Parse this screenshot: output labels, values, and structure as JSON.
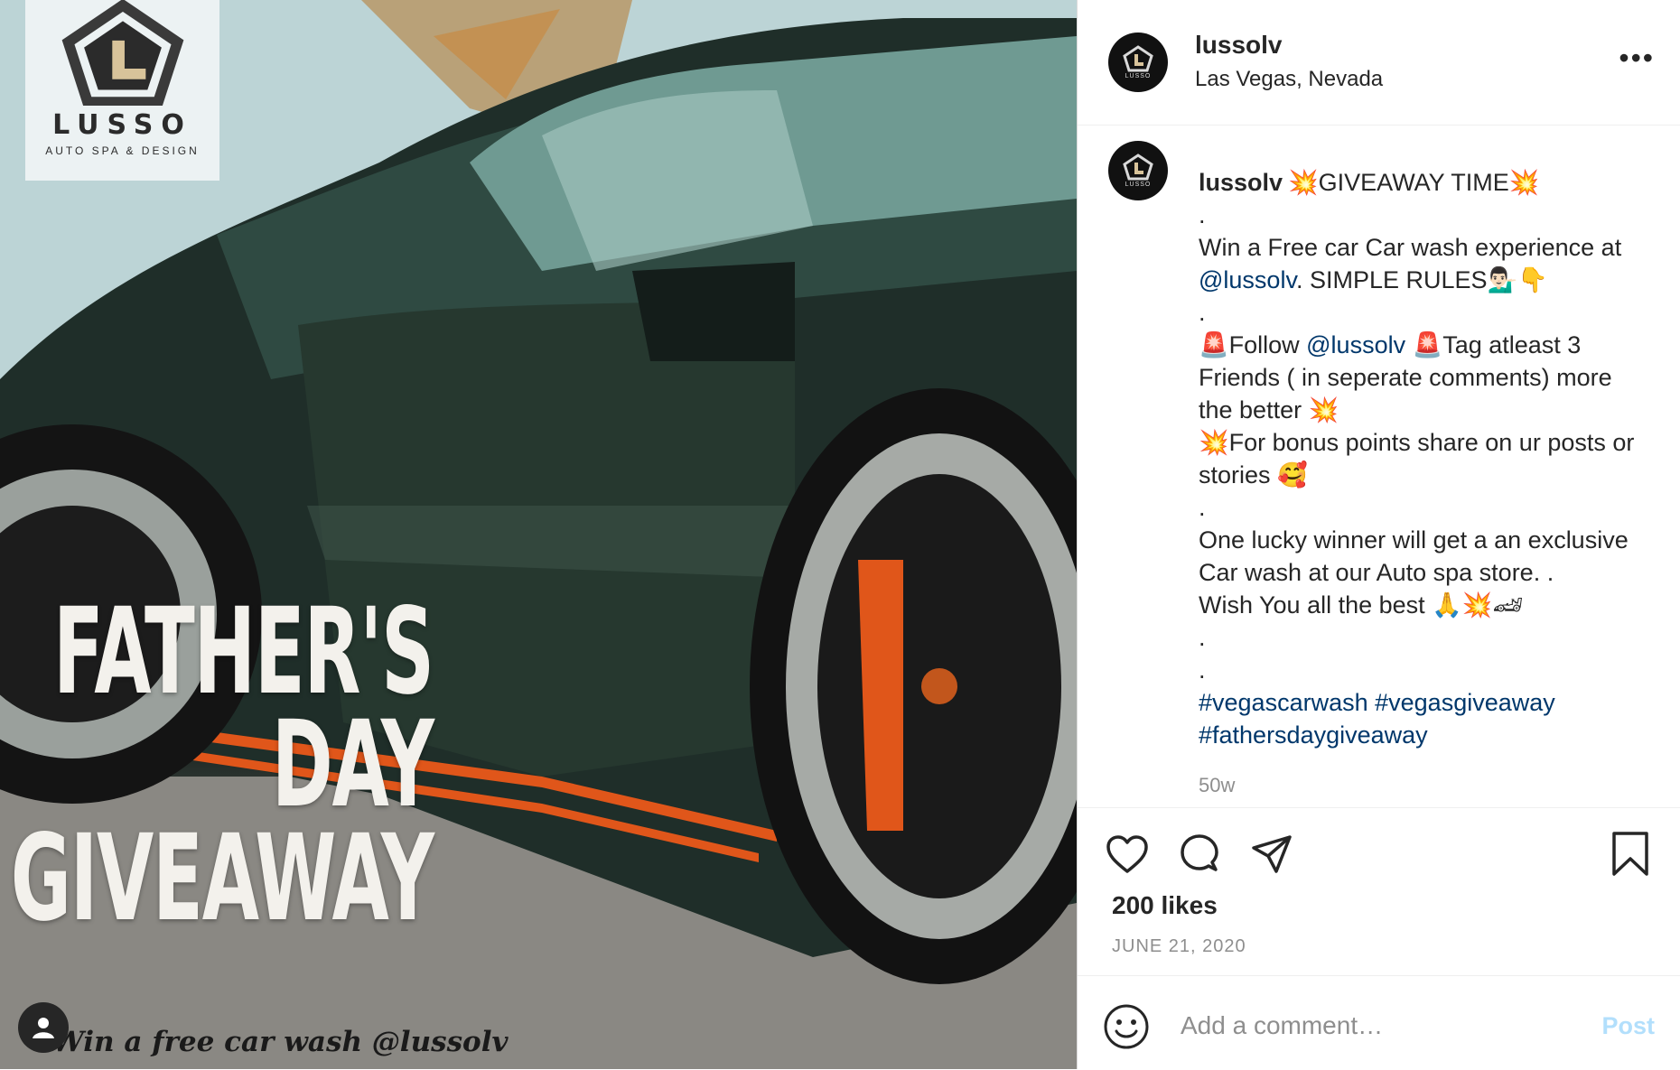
{
  "image": {
    "brand_word": "LUSSO",
    "brand_sub": "AUTO SPA & DESIGN",
    "hero_lines": [
      "FATHER'S",
      "DAY",
      "GIVEAWAY"
    ],
    "overlay_caption": "Win a free car wash @lussolv"
  },
  "header": {
    "username": "lussolv",
    "location": "Las Vegas, Nevada",
    "more_icon": "•••",
    "avatar_text": "LUSSO"
  },
  "caption": {
    "username": "lussolv",
    "title": "💥GIVEAWAY TIME💥",
    "lines": {
      "dot1": ".",
      "win_a": "Win a Free car Car wash experience at",
      "mention1": "@lussolv",
      "win_b": ". SIMPLE RULES💁🏻‍♂️👇",
      "dot2": ".",
      "siren1": "🚨Follow ",
      "mention2": "@lussolv",
      "siren2": " 🚨Tag atleast 3",
      "friends": "Friends ( in seperate comments) more",
      "better": "the better 💥",
      "bonus": "💥For bonus points share on ur posts or",
      "stories": "stories 🥰",
      "dot3": ".",
      "winner": "One lucky winner will get a an exclusive",
      "carwash": "Car wash at our Auto spa store. .",
      "wish": "Wish You all the best 🙏💥🏎",
      "dot4": ".",
      "dot5": ".",
      "hashtag1": "#vegascarwash",
      "hashtag2": "#vegasgiveaway",
      "hashtag3": "#fathersdaygiveaway"
    },
    "age": "50w"
  },
  "actions": {
    "likes": "200 likes",
    "date": "JUNE 21, 2020"
  },
  "comment_box": {
    "placeholder": "Add a comment…",
    "post_label": "Post"
  },
  "colors": {
    "link": "#00376b",
    "post_button_disabled": "#b2dffc",
    "muted": "#8e8e8e"
  },
  "icons": [
    "heart-icon",
    "comment-icon",
    "share-icon",
    "bookmark-icon",
    "smiley-icon",
    "user-tag-icon",
    "more-options-icon"
  ]
}
